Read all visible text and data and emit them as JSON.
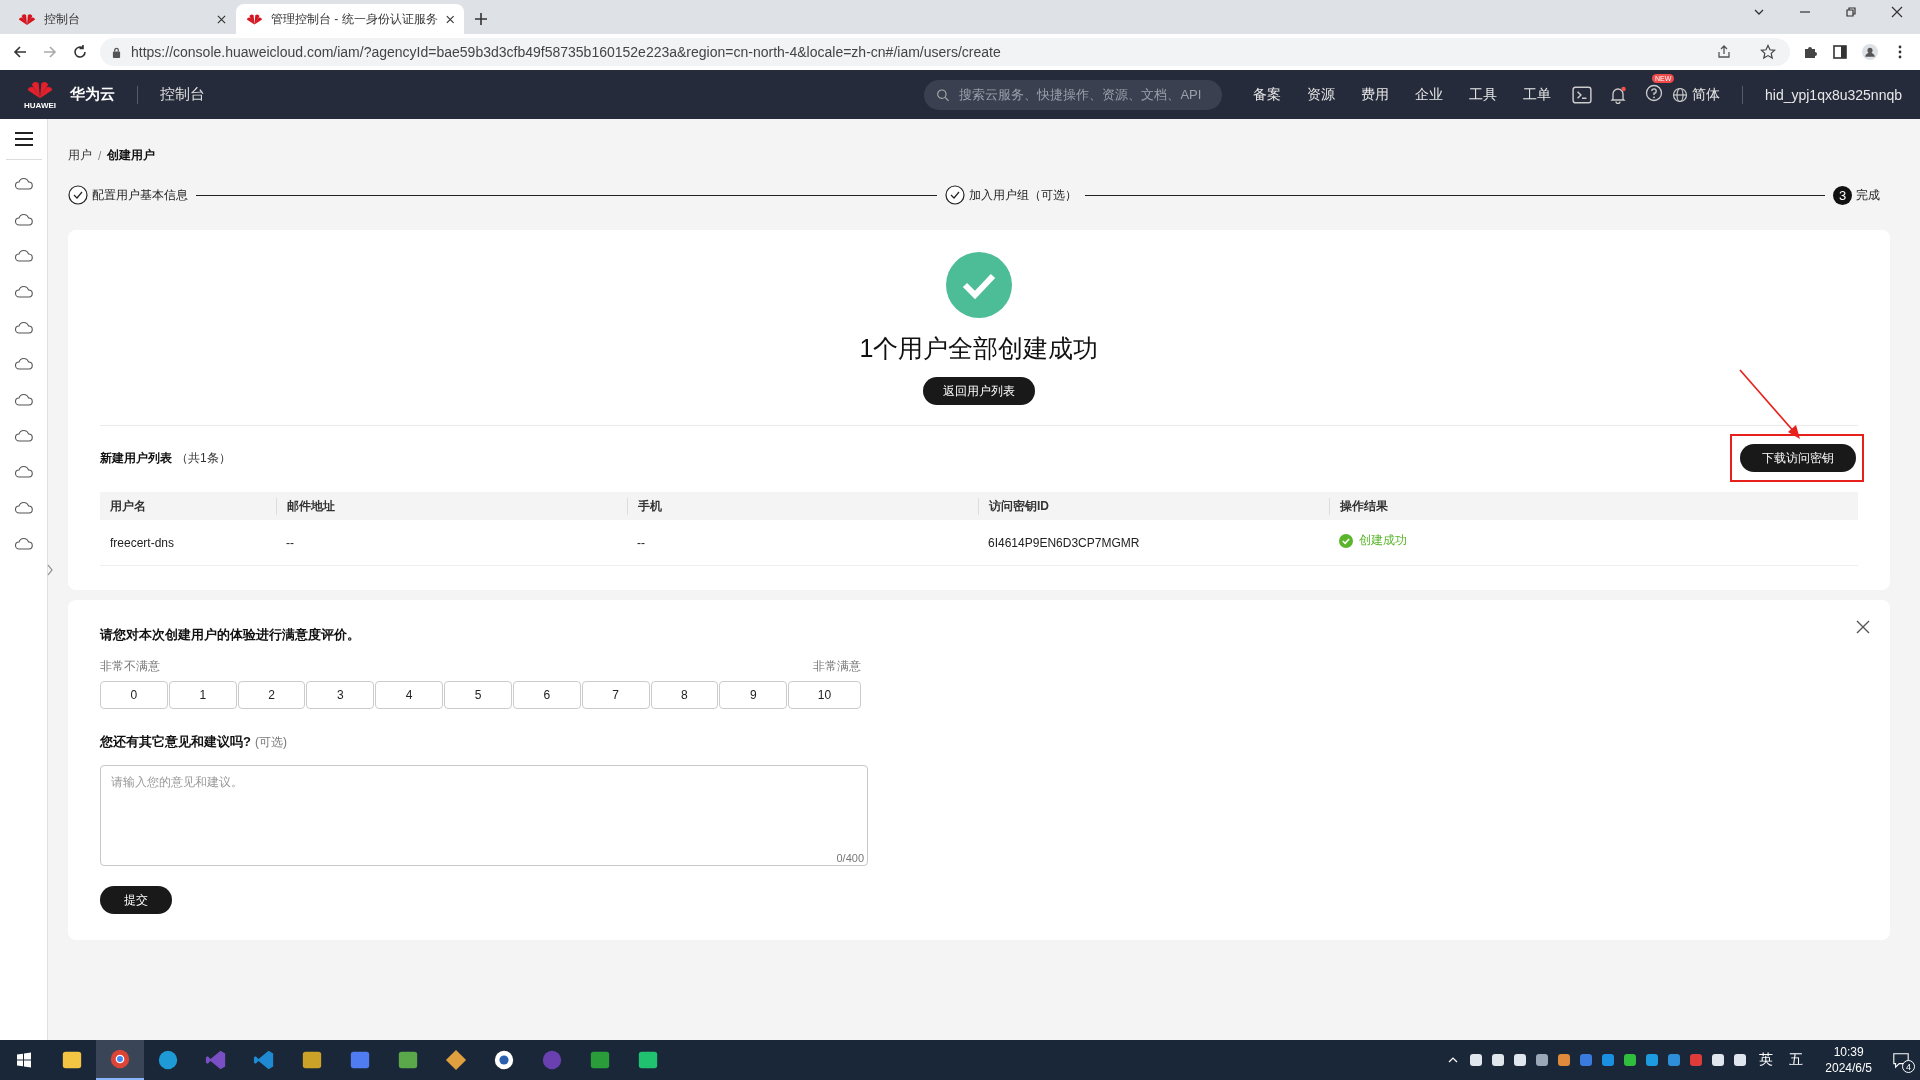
{
  "browser": {
    "tabs": [
      {
        "title": "控制台",
        "selected": false
      },
      {
        "title": "管理控制台 - 统一身份认证服务",
        "selected": true
      }
    ],
    "url": "https://console.huaweicloud.com/iam/?agencyId=bae59b3d3cfb49f58735b160152e223a&region=cn-north-4&locale=zh-cn#/iam/users/create"
  },
  "header": {
    "brand": "华为云",
    "logo_text": "HUAWEI",
    "console": "控制台",
    "search": {
      "placeholder": "搜索云服务、快捷操作、资源、文档、API"
    },
    "nav": [
      "备案",
      "资源",
      "费用",
      "企业",
      "工具",
      "工单"
    ],
    "new_badge": "NEW",
    "language": "简体",
    "account": "hid_ypj1qx8u325nnqb"
  },
  "breadcrumb": [
    "用户",
    "创建用户"
  ],
  "breadcrumb_separator": "/",
  "steps": [
    {
      "label": "配置用户基本信息",
      "kind": "done"
    },
    {
      "label": "加入用户组（可选）",
      "kind": "done"
    },
    {
      "label": "完成",
      "kind": "current",
      "number": "3"
    }
  ],
  "result": {
    "title": "1个用户全部创建成功",
    "back_button": "返回用户列表",
    "list_title": "新建用户列表",
    "list_count": "（共1条）",
    "download_button": "下载访问密钥",
    "table": {
      "columns": [
        "用户名",
        "邮件地址",
        "手机",
        "访问密钥ID",
        "操作结果"
      ],
      "rows": [
        {
          "cells": [
            "freecert-dns",
            "--",
            "--",
            "6I4614P9EN6D3CP7MGMR"
          ],
          "status": "创建成功"
        }
      ]
    }
  },
  "survey": {
    "question": "请您对本次创建用户的体验进行满意度评价。",
    "low_label": "非常不满意",
    "high_label": "非常满意",
    "scale": [
      "0",
      "1",
      "2",
      "3",
      "4",
      "5",
      "6",
      "7",
      "8",
      "9",
      "10"
    ],
    "comment_label": "您还有其它意见和建议吗?",
    "comment_optional": "(可选)",
    "comment": {
      "placeholder": "请输入您的意见和建议。"
    },
    "counter": "0/400",
    "submit": "提交"
  },
  "taskbar": {
    "apps": [
      {
        "kind": "folder",
        "selected": false
      },
      {
        "kind": "chrome",
        "selected": true
      },
      {
        "kind": "edge",
        "selected": false
      },
      {
        "kind": "vs",
        "selected": false
      },
      {
        "kind": "vscode",
        "selected": false
      },
      {
        "kind": "tools",
        "selected": false
      },
      {
        "kind": "pen",
        "selected": false
      },
      {
        "kind": "notepad",
        "selected": false
      },
      {
        "kind": "git",
        "selected": false
      },
      {
        "kind": "circle",
        "selected": false
      },
      {
        "kind": "orb",
        "selected": false
      },
      {
        "kind": "hbuilder",
        "selected": false
      },
      {
        "kind": "webstorm",
        "selected": false
      }
    ],
    "ime": "英",
    "ime_mode": "五",
    "time": "10:39",
    "date": "2024/6/5",
    "notifications": "4"
  }
}
